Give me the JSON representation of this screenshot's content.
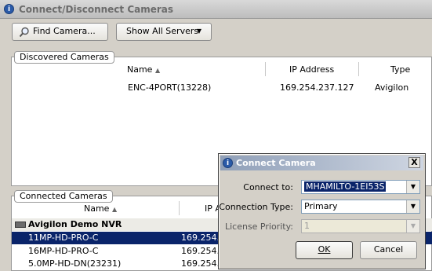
{
  "window": {
    "title": "Connect/Disconnect Cameras"
  },
  "toolbar": {
    "find_camera": "Find Camera...",
    "show_all_servers": "Show All Servers"
  },
  "discovered": {
    "legend": "Discovered Cameras",
    "columns": {
      "name": "Name",
      "ip": "IP Address",
      "type": "Type"
    },
    "rows": [
      {
        "name": "ENC-4PORT(13228)",
        "ip": "169.254.237.127",
        "type": "Avigilon"
      }
    ]
  },
  "connected": {
    "legend": "Connected Cameras",
    "columns": {
      "name": "Name",
      "ip": "IP A"
    },
    "group": "Avigilon Demo NVR",
    "rows": [
      {
        "name": "11MP-HD-PRO-C",
        "ip": "169.254.2"
      },
      {
        "name": "16MP-HD-PRO-C",
        "ip": "169.254.2"
      },
      {
        "name": "5.0MP-HD-DN(23231)",
        "ip": "169.254.2"
      }
    ]
  },
  "dialog": {
    "title": "Connect Camera",
    "close": "X",
    "connect_to_label": "Connect to:",
    "connect_to_value": "MHAMILTO-1EI53S",
    "connection_type_label": "Connection Type:",
    "connection_type_value": "Primary",
    "license_priority_label": "License Priority:",
    "license_priority_value": "1",
    "ok": "OK",
    "cancel": "Cancel"
  }
}
